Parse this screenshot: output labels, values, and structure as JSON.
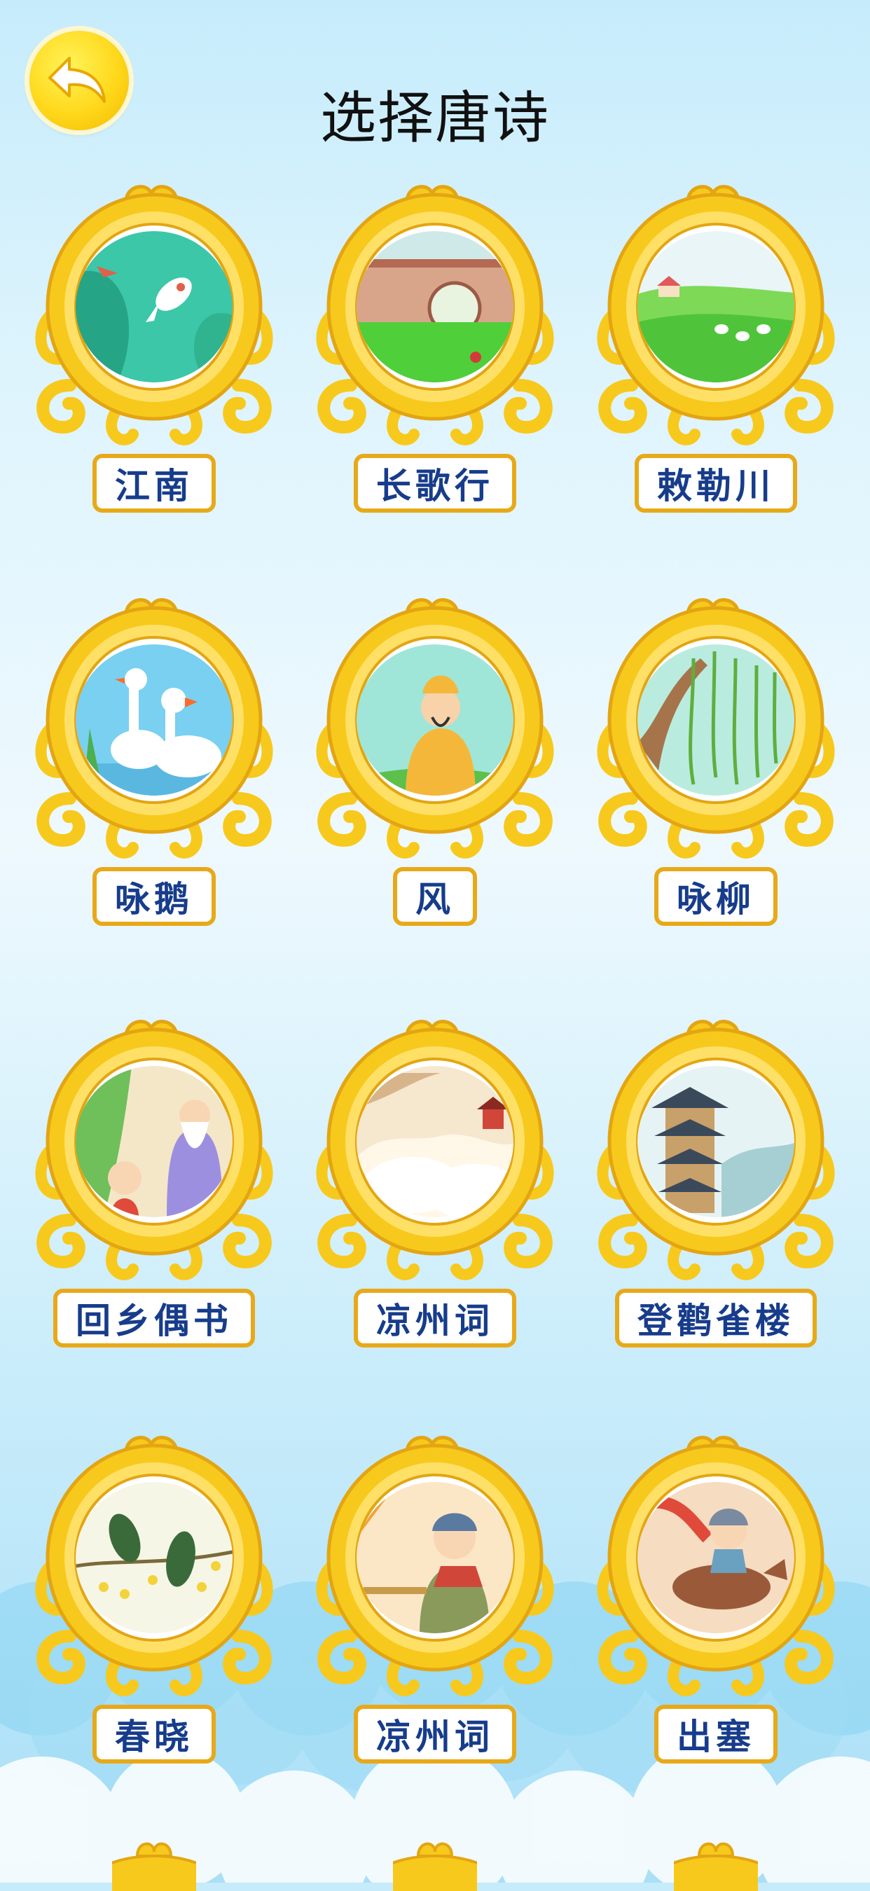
{
  "header": {
    "title": "选择唐诗",
    "back_icon": "back-arrow-icon"
  },
  "colors": {
    "frame_gold": "#f7c91c",
    "label_border": "#e8a919",
    "label_text": "#173c8c",
    "back_yellow": "#ffd81b"
  },
  "poems": [
    {
      "title": "江南",
      "image": "fish-lotus-pond"
    },
    {
      "title": "长歌行",
      "image": "courtyard-moon-gate"
    },
    {
      "title": "敕勒川",
      "image": "grassland-sheep"
    },
    {
      "title": "咏鹅",
      "image": "white-geese"
    },
    {
      "title": "风",
      "image": "poet-in-yellow-robe"
    },
    {
      "title": "咏柳",
      "image": "willow-tree"
    },
    {
      "title": "回乡偶书",
      "image": "old-man-and-child"
    },
    {
      "title": "凉州词",
      "image": "mountain-clouds"
    },
    {
      "title": "登鹳雀楼",
      "image": "tower-pavilion"
    },
    {
      "title": "春晓",
      "image": "birds-on-branch"
    },
    {
      "title": "凉州词",
      "image": "soldier-drinking"
    },
    {
      "title": "出塞",
      "image": "general-on-horse"
    }
  ]
}
